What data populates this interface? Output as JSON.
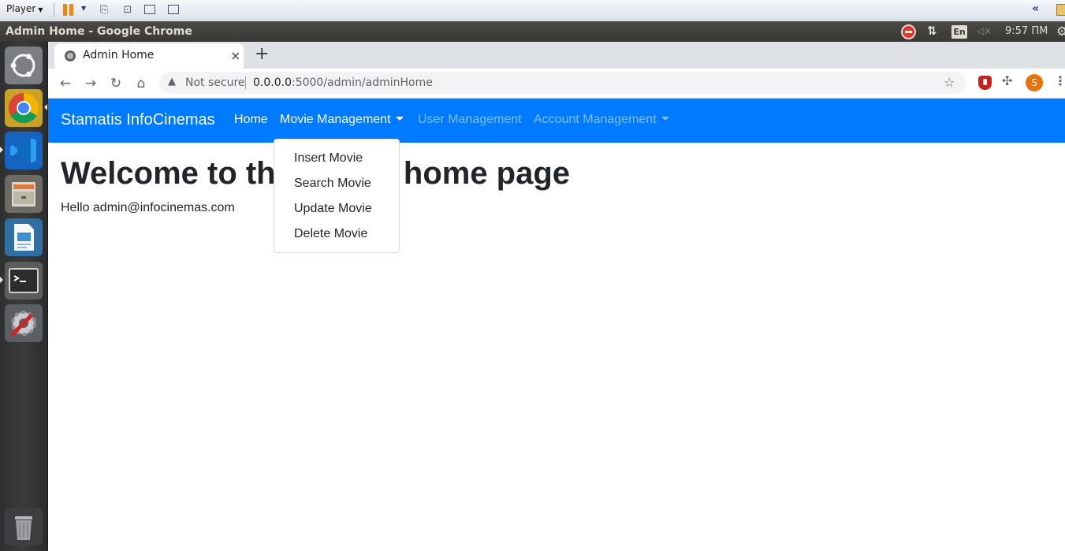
{
  "vm_player": {
    "menu_label": "Player"
  },
  "os_panel": {
    "window_title": "Admin Home - Google Chrome",
    "keyboard_layout": "En",
    "clock": "9:57 ПМ"
  },
  "launcher": {
    "apps": [
      "ubuntu-dash-icon",
      "chrome-icon",
      "vscode-icon",
      "files-icon",
      "libreoffice-impress-icon",
      "terminal-icon",
      "system-settings-icon",
      "trash-icon"
    ]
  },
  "browser": {
    "tab": {
      "title": "Admin Home",
      "close_glyph": "×"
    },
    "new_tab_glyph": "+",
    "address": {
      "security_label": "Not secure",
      "host": "0.0.0.0",
      "path": ":5000/admin/adminHome"
    },
    "profile_initial": "S"
  },
  "site": {
    "brand": "Stamatis InfoCinemas",
    "nav": {
      "home": "Home",
      "movie_management": "Movie Management",
      "user_management": "User Management",
      "account_management": "Account Management"
    },
    "dropdown": {
      "items": [
        "Insert Movie",
        "Search Movie",
        "Update Movie",
        "Delete Movie"
      ]
    },
    "heading": "Welcome to the admin home page",
    "greeting": "Hello admin@infocinemas.com"
  },
  "colors": {
    "navbar": "#007bff",
    "text": "#212529"
  }
}
